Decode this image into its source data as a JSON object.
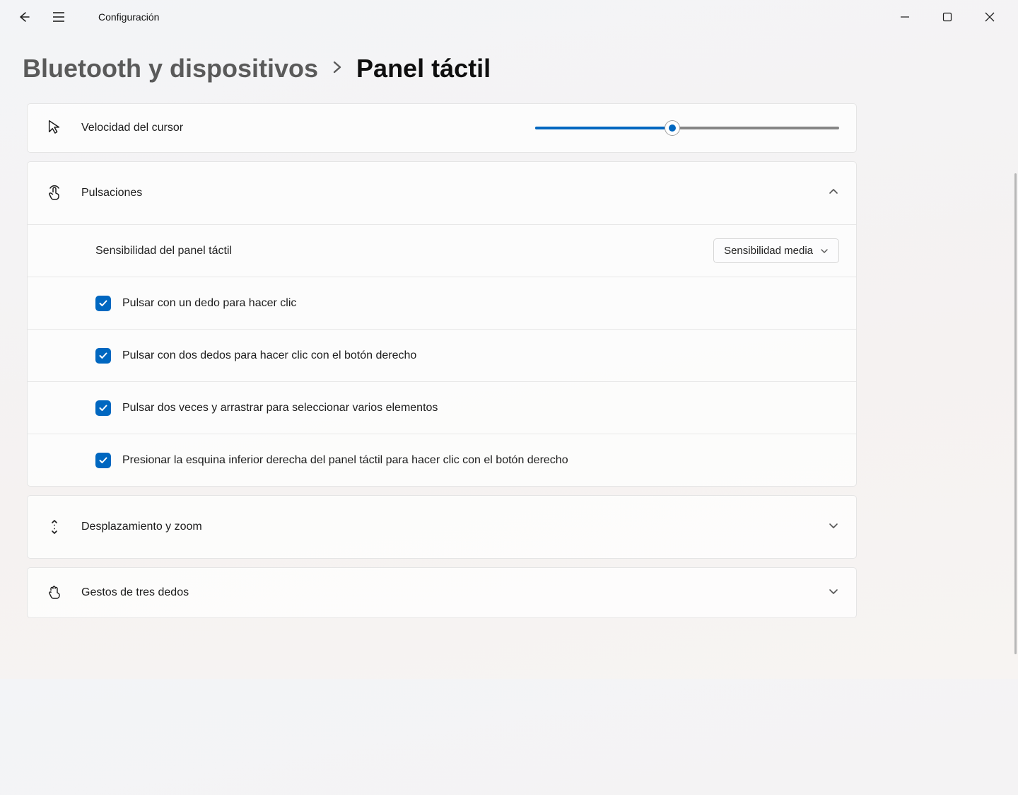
{
  "window": {
    "app_title": "Configuración"
  },
  "breadcrumb": {
    "parent": "Bluetooth y dispositivos",
    "current": "Panel táctil"
  },
  "cursor_speed": {
    "label": "Velocidad del cursor",
    "value_percent": 45
  },
  "taps": {
    "header": "Pulsaciones",
    "sensitivity_label": "Sensibilidad del panel táctil",
    "sensitivity_value": "Sensibilidad media",
    "options": [
      {
        "label": "Pulsar con un dedo para hacer clic",
        "checked": true
      },
      {
        "label": "Pulsar con dos dedos para hacer clic con el botón derecho",
        "checked": true
      },
      {
        "label": "Pulsar dos veces y arrastrar para seleccionar varios elementos",
        "checked": true
      },
      {
        "label": "Presionar la esquina inferior derecha del panel táctil para hacer clic con el botón derecho",
        "checked": true
      }
    ]
  },
  "scroll_zoom": {
    "header": "Desplazamiento y zoom"
  },
  "three_finger": {
    "header": "Gestos de tres dedos"
  },
  "colors": {
    "accent": "#0067c0"
  }
}
